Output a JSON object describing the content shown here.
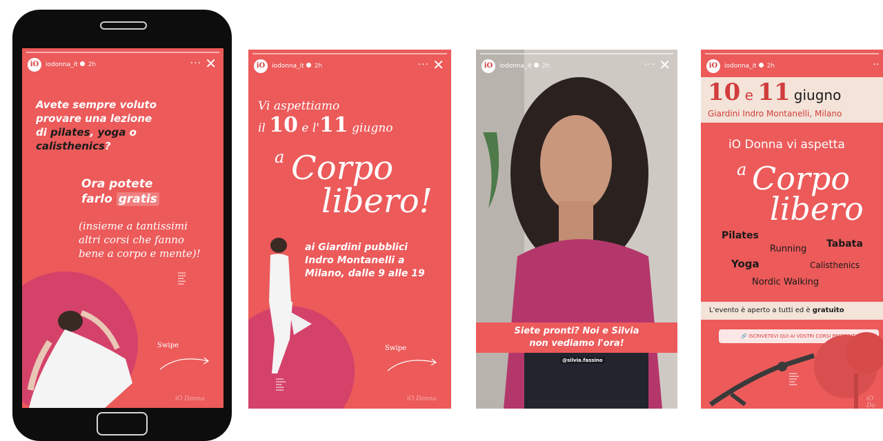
{
  "account": {
    "username": "iodonna_it",
    "time": "2h",
    "logo": "iO"
  },
  "icons": {
    "more": "more-icon",
    "close": "close-icon",
    "verified": "verified-badge-icon"
  },
  "colors": {
    "story_bg": "#ec5a5a",
    "accent_pink": "#d4426a",
    "banner_beige": "#f3e3d8"
  },
  "story1": {
    "q_line1": "Avete sempre voluto",
    "q_line2": "provare una lezione",
    "q_di": "di ",
    "q_pilates": "pilates",
    "q_comma": ", ",
    "q_yoga": "yoga",
    "q_o": " o",
    "q_calisthenics": "calisthenics",
    "q_mark": "?",
    "ora": "Ora potete",
    "farlo": "farlo ",
    "gratis": "gratis",
    "paren1": "(insieme a tantissimi",
    "paren2": "altri corsi che fanno",
    "paren3": "bene a corpo e mente)!",
    "swipe": "Swipe",
    "signature": "iO Donna"
  },
  "story2": {
    "vi": "Vi aspettiamo",
    "il": "il",
    "d10": "10",
    "el": " e l'",
    "d11": "11",
    "giugno": " giugno",
    "a": "a",
    "corpo": "Corpo",
    "libero": "libero!",
    "where1": "ai Giardini pubblici",
    "where2": "Indro Montanelli a",
    "where3": "Milano, dalle 9 alle 19",
    "swipe": "Swipe",
    "signature": "iO Donna"
  },
  "story3": {
    "caption1": "Siete pronti? Noi e Silvia",
    "caption2": "non vediamo l'ora!",
    "tag": "@silvia.fassino"
  },
  "story4": {
    "d10": "10",
    "e": " e ",
    "d11": "11",
    "giugno": "giugno",
    "place": "Giardini Indro Montanelli, Milano",
    "aspetta": "iO Donna vi aspetta",
    "a": "a",
    "corpo": "Corpo",
    "libero": "libero",
    "courses": [
      "Pilates",
      "Running",
      "Tabata",
      "Yoga",
      "Calisthenics",
      "Nordic Walking"
    ],
    "aperto": "L'evento è aperto a tutti ed è ",
    "gratuito": "gratuito",
    "link": "ISCRIVETEVI QUI AI VOSTRI CORSI PREFERITI",
    "signature": "iO Do"
  }
}
